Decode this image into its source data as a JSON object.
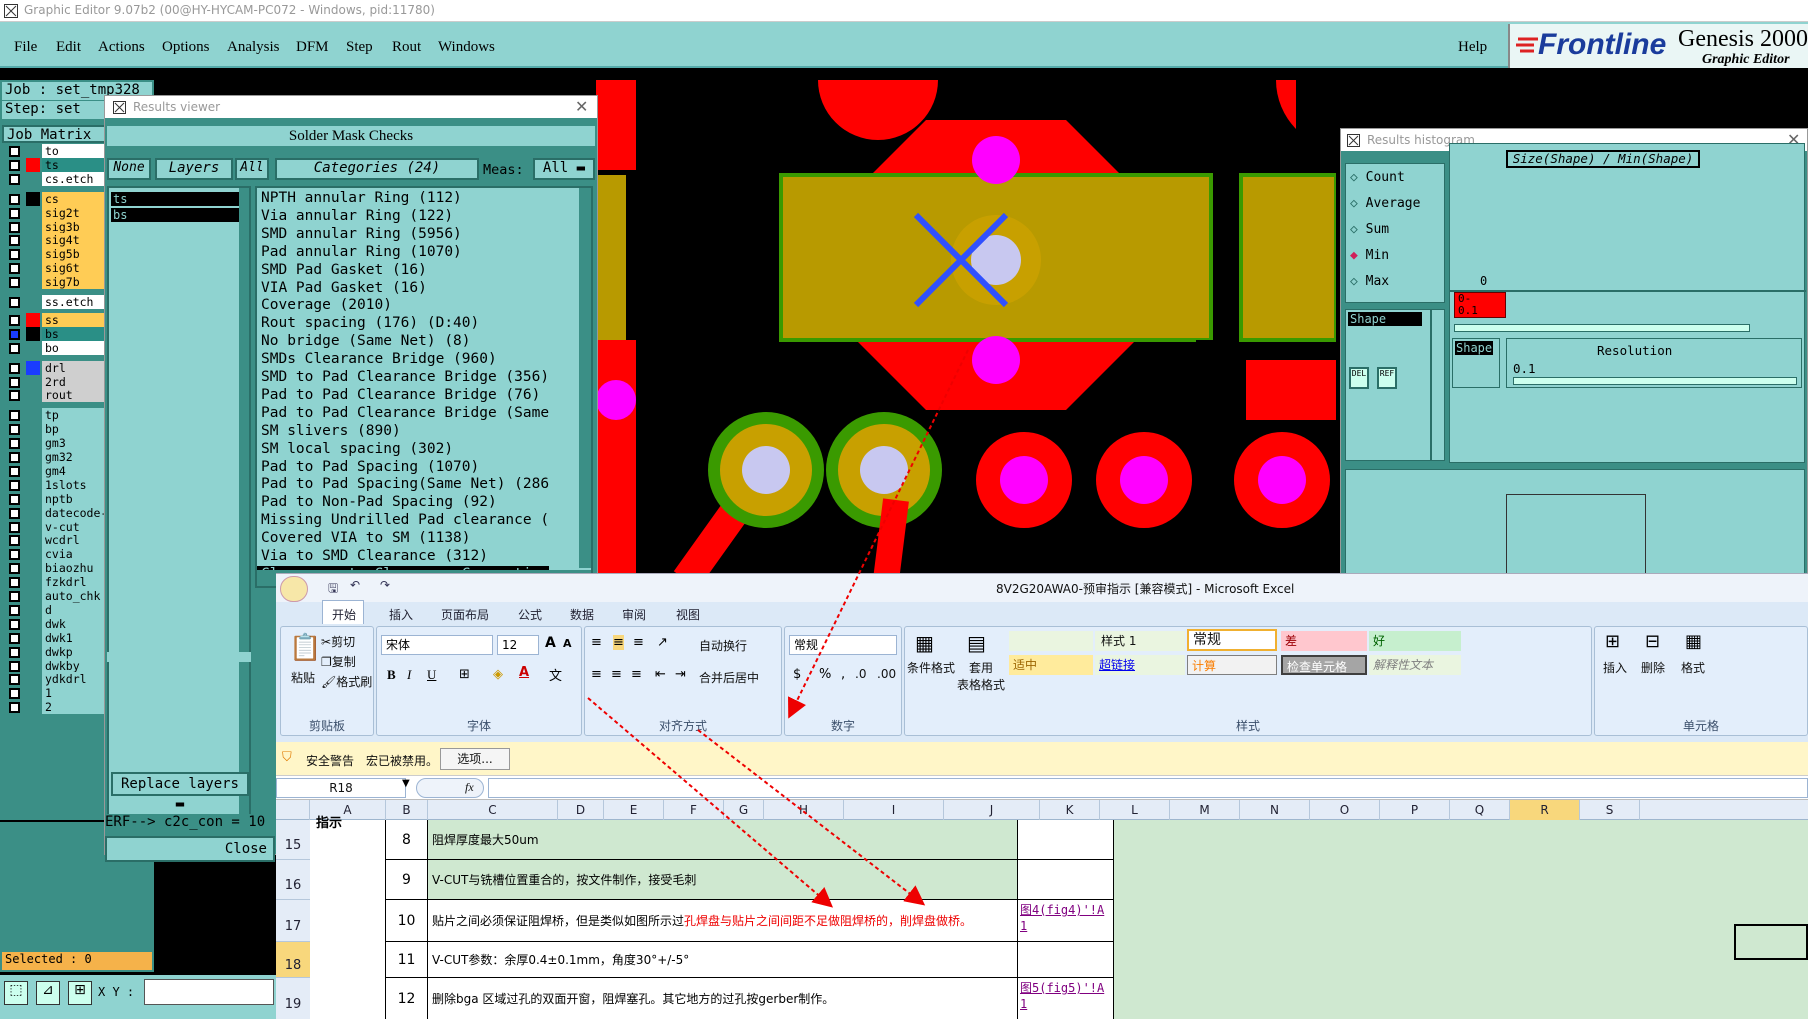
{
  "genesis": {
    "title": "Graphic Editor 9.07b2 (00@HY-HYCAM-PC072 - Windows, pid:11780)",
    "menu": [
      "File",
      "Edit",
      "Actions",
      "Options",
      "Analysis",
      "DFM",
      "Step",
      "Rout",
      "Windows"
    ],
    "help": "Help",
    "brand": {
      "logo": "Frontline",
      "product": "Genesis 2000",
      "subtitle": "Graphic Editor"
    },
    "job": "Job : set_tmp328",
    "step": "Step: set",
    "job_matrix": "Job Matrix",
    "layers": [
      {
        "name": "to",
        "color": "#ffffff"
      },
      {
        "name": "ts",
        "color": "#2a8f86"
      },
      {
        "name": "cs.etch",
        "color": "#ffffff"
      },
      {
        "name": "cs",
        "color": "#ffcc55"
      },
      {
        "name": "sig2t",
        "color": "#ffcc55"
      },
      {
        "name": "sig3b",
        "color": "#ffcc55"
      },
      {
        "name": "sig4t",
        "color": "#ffcc55"
      },
      {
        "name": "sig5b",
        "color": "#ffcc55"
      },
      {
        "name": "sig6t",
        "color": "#ffcc55"
      },
      {
        "name": "sig7b",
        "color": "#ffcc55"
      },
      {
        "name": "ss.etch",
        "color": "#ffffff"
      },
      {
        "name": "ss",
        "color": "#ffcc55"
      },
      {
        "name": "bs",
        "color": "#2a8f86"
      },
      {
        "name": "bo",
        "color": "#ffffff"
      },
      {
        "name": "drl",
        "color": "#cfcfcf"
      },
      {
        "name": "2rd",
        "color": "#cfcfcf"
      },
      {
        "name": "rout",
        "color": "#cfcfcf"
      },
      {
        "name": "tp",
        "color": "#8fd3d0"
      },
      {
        "name": "bp",
        "color": "#8fd3d0"
      },
      {
        "name": "gm3",
        "color": "#8fd3d0"
      },
      {
        "name": "gm32",
        "color": "#8fd3d0"
      },
      {
        "name": "gm4",
        "color": "#8fd3d0"
      },
      {
        "name": "1slots",
        "color": "#8fd3d0"
      },
      {
        "name": "nptb",
        "color": "#8fd3d0"
      },
      {
        "name": "datecode-",
        "color": "#8fd3d0"
      },
      {
        "name": "v-cut",
        "color": "#8fd3d0"
      },
      {
        "name": "wcdrl",
        "color": "#8fd3d0"
      },
      {
        "name": "cvia",
        "color": "#8fd3d0"
      },
      {
        "name": "biaozhu",
        "color": "#8fd3d0"
      },
      {
        "name": "fzkdrl",
        "color": "#8fd3d0"
      },
      {
        "name": "auto_chk",
        "color": "#8fd3d0"
      },
      {
        "name": "d",
        "color": "#8fd3d0"
      },
      {
        "name": "dwk",
        "color": "#8fd3d0"
      },
      {
        "name": "dwk1",
        "color": "#8fd3d0"
      },
      {
        "name": "dwkp",
        "color": "#8fd3d0"
      },
      {
        "name": "dwkby",
        "color": "#8fd3d0"
      },
      {
        "name": "ydkdrl",
        "color": "#8fd3d0"
      },
      {
        "name": "1",
        "color": "#8fd3d0"
      },
      {
        "name": "2",
        "color": "#8fd3d0"
      }
    ],
    "selected": "Selected : 0",
    "xy_label": "X Y :",
    "erf": "ERF--> c2c_con = 10",
    "close": "Close"
  },
  "results_viewer": {
    "title": "Results viewer",
    "header": "Solder Mask Checks",
    "none": "None",
    "layers": "Layers",
    "all": "All",
    "categories_btn": "Categories (24)",
    "meas": "Meas:",
    "meas_value": "All",
    "layer_list": [
      "ts",
      "bs"
    ],
    "categories": [
      "NPTH annular Ring (112)",
      "Via annular Ring (122)",
      "SMD annular Ring (5956)",
      "Pad annular Ring (1070)",
      "SMD Pad Gasket (16)",
      "VIA Pad Gasket (16)",
      "Coverage (2010)",
      "Rout spacing (176)          (D:40)",
      "No bridge (Same Net) (8)",
      "SMDs Clearance Bridge (960)",
      "SMD to Pad Clearance Bridge (356)",
      "Pad to Pad Clearance Bridge (76)",
      "Pad to Pad Clearance Bridge (Same",
      "SM slivers (890)",
      "SM local spacing (302)",
      "Pad to Pad Spacing (1070)",
      "Pad to Pad Spacing(Same Net) (286",
      "Pad to Non-Pad Spacing (92)",
      "Missing Undrilled Pad clearance (",
      "Covered VIA to SM (1138)",
      "Via to SMD Clearance (312)",
      "Clearance to Clearance Connection"
    ],
    "replace": "Replace layers"
  },
  "histogram": {
    "title": "Results histogram",
    "options": [
      "Count",
      "Average",
      "Sum",
      "Min",
      "Max"
    ],
    "selected_option": "Min",
    "plot_title": "Size(Shape) / Min(Shape)",
    "zero": "0",
    "bin_label": "0-\n0.1",
    "shape": "Shape",
    "resolution": "Resolution",
    "resolution_value": "0.1",
    "del": "DEL",
    "ref": "REF"
  },
  "excel": {
    "title": "8V2G20AWA0-预审指示  [兼容模式] - Microsoft Excel",
    "tabs": [
      "开始",
      "插入",
      "页面布局",
      "公式",
      "数据",
      "审阅",
      "视图"
    ],
    "clipboard": {
      "paste": "粘贴",
      "cut": "剪切",
      "copy": "复制",
      "painter": "格式刷",
      "label": "剪贴板"
    },
    "font": {
      "name": "宋体",
      "size": "12",
      "label": "字体"
    },
    "align": {
      "wrap": "自动换行",
      "merge": "合并后居中",
      "label": "对齐方式"
    },
    "number": {
      "format": "常规",
      "label": "数字"
    },
    "styles": {
      "cond": "条件格式",
      "table": "套用\n表格格式",
      "cells": [
        "样式 1",
        "常规",
        "差",
        "好",
        "适中",
        "超链接",
        "计算",
        "检查单元格",
        "解释性文本"
      ],
      "label": "样式"
    },
    "cellgroup": {
      "insert": "插入",
      "delete": "删除",
      "format": "格式",
      "label": "单元格"
    },
    "security": {
      "warn": "安全警告",
      "msg": "宏已被禁用。",
      "btn": "选项..."
    },
    "namebox": "R18",
    "fx": "fx",
    "columns": [
      "A",
      "B",
      "C",
      "D",
      "E",
      "F",
      "G",
      "H",
      "I",
      "J",
      "K",
      "L",
      "M",
      "N",
      "O",
      "P",
      "Q",
      "R",
      "S"
    ],
    "a_partial": "指示",
    "rows": [
      {
        "num": "15",
        "b": "8",
        "c": "阻焊厚度最大50um",
        "j": ""
      },
      {
        "num": "16",
        "b": "9",
        "c": "V-CUT与铣槽位置重合的，按文件制作，接受毛刺",
        "j": ""
      },
      {
        "num": "17",
        "b": "10",
        "c_black": "贴片之间必须保证阻焊桥，但是类似如图所示过",
        "c_red": "孔焊盘与贴片之间间距不足做阻焊桥的，削焊盘做桥。",
        "j": "图4(fig4)'!A1"
      },
      {
        "num": "18",
        "b": "11",
        "c": "V-CUT参数：余厚0.4±0.1mm，角度30°+/-5°",
        "j": ""
      },
      {
        "num": "19",
        "b": "12",
        "c": "删除bga 区域过孔的双面开窗，阻焊塞孔。其它地方的过孔按gerber制作。",
        "j": "图5(fig5)'!A1"
      }
    ]
  }
}
